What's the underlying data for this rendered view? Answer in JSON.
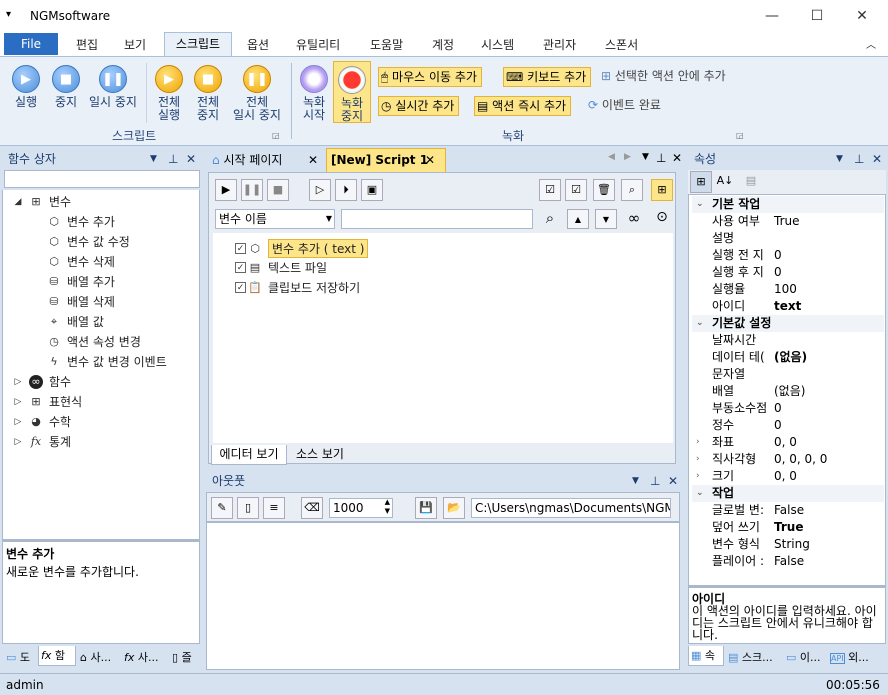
{
  "app": {
    "title": "NGMsoftware",
    "menu_icon": "system-menu-icon"
  },
  "window_controls": {
    "minimize": "—",
    "maximize": "☐",
    "close": "✕"
  },
  "menu": {
    "file": "File",
    "items": [
      "편집",
      "보기",
      "스크립트",
      "옵션",
      "유틸리티",
      "도움말",
      "계정",
      "시스템",
      "관리자",
      "스폰서"
    ]
  },
  "ribbon": {
    "script_group": {
      "label": "스크립트",
      "run": "실행",
      "stop": "중지",
      "pause": "일시 중지",
      "all_run_1": "전체",
      "all_run_2": "실행",
      "all_stop_1": "전체",
      "all_stop_2": "중지",
      "all_pause_1": "전체",
      "all_pause_2": "일시 중지"
    },
    "record_group": {
      "label": "녹화",
      "rec_start_1": "녹화",
      "rec_start_2": "시작",
      "rec_stop_1": "녹화",
      "rec_stop_2": "중지",
      "mouse_move": "마우스 이동 추가",
      "keyboard": "키보드 추가",
      "realtime": "실시간 추가",
      "action_instant": "액션 즉시 추가",
      "add_in_selected": "선택한 액션 안에 추가",
      "event_done": "이벤트 완료"
    }
  },
  "left_panel": {
    "title": "함수 상자",
    "items": [
      {
        "label": "변수"
      },
      {
        "label": "변수 추가"
      },
      {
        "label": "변수 값 수정"
      },
      {
        "label": "변수 삭제"
      },
      {
        "label": "배열 추가"
      },
      {
        "label": "배열 삭제"
      },
      {
        "label": "배열 값"
      },
      {
        "label": "액션 속성 변경"
      },
      {
        "label": "변수 값 변경 이벤트"
      },
      {
        "label": "함수"
      },
      {
        "label": "표현식"
      },
      {
        "label": "수학"
      },
      {
        "label": "통계"
      }
    ],
    "desc_title": "변수 추가",
    "desc_text": "새로운 변수를 추가합니다.",
    "tabs": [
      "도",
      "함",
      "사...",
      "사...",
      "즐"
    ]
  },
  "editor": {
    "tabs": [
      "시작 페이지",
      "[New] Script 1"
    ],
    "search_combo": "변수 이름",
    "search_value": "",
    "rows": [
      "변수 추가 ( text )",
      "텍스트 파일",
      "클립보드 저장하기"
    ],
    "bottom_tabs": [
      "에디터 보기",
      "소스 보기"
    ]
  },
  "output": {
    "title": "아웃풋",
    "count": "1000",
    "path": "C:\\Users\\ngmas\\Documents\\NGM6\\"
  },
  "properties": {
    "title": "속성",
    "rows": [
      {
        "cat": true,
        "k": "기본 작업"
      },
      {
        "k": "사용 여부",
        "v": "True"
      },
      {
        "k": "설명",
        "v": ""
      },
      {
        "k": "실행 전 지",
        "v": "0"
      },
      {
        "k": "실행 후 지",
        "v": "0"
      },
      {
        "k": "실행율",
        "v": "100"
      },
      {
        "k": "아이디",
        "v": "text",
        "b": true
      },
      {
        "cat": true,
        "k": "기본값 설정"
      },
      {
        "k": "날짜시간",
        "v": ""
      },
      {
        "k": "데이터 테(",
        "v": "(없음)",
        "b": true
      },
      {
        "k": "문자열",
        "v": ""
      },
      {
        "k": "배열",
        "v": "(없음)"
      },
      {
        "k": "부동소수점",
        "v": "0"
      },
      {
        "k": "정수",
        "v": "0"
      },
      {
        "k": "좌표",
        "v": "0, 0",
        "exp": true
      },
      {
        "k": "직사각형",
        "v": "0, 0, 0, 0",
        "exp": true
      },
      {
        "k": "크기",
        "v": "0, 0",
        "exp": true
      },
      {
        "cat": true,
        "k": "작업"
      },
      {
        "k": "글로벌 변:",
        "v": "False"
      },
      {
        "k": "덮어 쓰기",
        "v": "True",
        "b": true
      },
      {
        "k": "변수 형식",
        "v": "String"
      },
      {
        "k": "플레이어 :",
        "v": "False"
      }
    ],
    "desc_title": "아이디",
    "desc_text": "이 액션의 아이디를 입력하세요. 아이디는 스크립트 안에서 유니크해야 합니다.",
    "tabs": [
      "속",
      "스크...",
      "이...",
      "외..."
    ]
  },
  "status": {
    "user": "admin",
    "time": "00:05:56"
  }
}
